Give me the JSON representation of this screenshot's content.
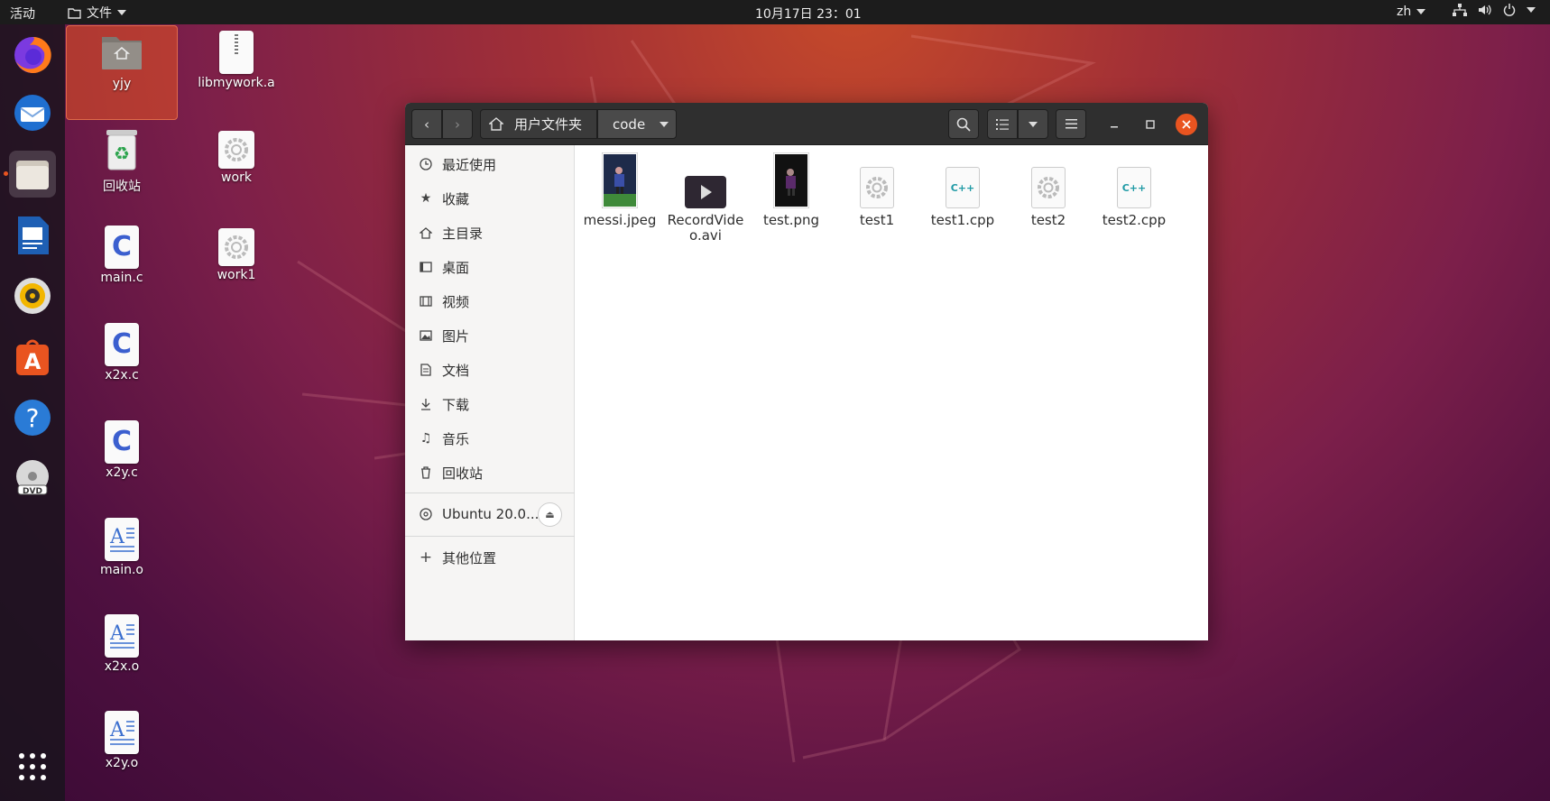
{
  "topbar": {
    "activities": "活动",
    "app_menu": "文件",
    "clock": "10月17日  23：01",
    "lang": "zh"
  },
  "dock": {
    "items": [
      "firefox-icon",
      "thunderbird-icon",
      "files-icon",
      "writer-icon",
      "rhythmbox-icon",
      "software-icon",
      "help-icon",
      "dvd-icon"
    ],
    "show_apps": "apps-grid-icon"
  },
  "desktop": {
    "icons": [
      {
        "label": "yjy"
      },
      {
        "label": "libmywork.a"
      },
      {
        "label": "回收站"
      },
      {
        "label": "work"
      },
      {
        "label": "main.c"
      },
      {
        "label": "work1"
      },
      {
        "label": "x2x.c"
      },
      {
        "label": "x2y.c"
      },
      {
        "label": "main.o"
      },
      {
        "label": "x2x.o"
      },
      {
        "label": "x2y.o"
      }
    ]
  },
  "window": {
    "path": [
      "用户文件夹",
      "code"
    ],
    "sidebar": {
      "items": [
        {
          "label": "最近使用",
          "icon": "clock-icon"
        },
        {
          "label": "收藏",
          "icon": "star-icon"
        },
        {
          "label": "主目录",
          "icon": "home-icon"
        },
        {
          "label": "桌面",
          "icon": "desktop-icon"
        },
        {
          "label": "视频",
          "icon": "video-icon"
        },
        {
          "label": "图片",
          "icon": "image-icon"
        },
        {
          "label": "文档",
          "icon": "document-icon"
        },
        {
          "label": "下载",
          "icon": "download-icon"
        },
        {
          "label": "音乐",
          "icon": "music-icon"
        },
        {
          "label": "回收站",
          "icon": "trash-icon"
        }
      ],
      "device": "Ubuntu 20.0...",
      "other": "其他位置"
    },
    "files": [
      {
        "name": "messi.jpeg",
        "type": "image"
      },
      {
        "name": "RecordVideo.avi",
        "type": "video"
      },
      {
        "name": "test.png",
        "type": "image"
      },
      {
        "name": "test1",
        "type": "executable"
      },
      {
        "name": "test1.cpp",
        "type": "cpp"
      },
      {
        "name": "test2",
        "type": "executable"
      },
      {
        "name": "test2.cpp",
        "type": "cpp"
      }
    ],
    "cpp_label": "C++"
  },
  "colors": {
    "accent": "#e95420",
    "topbar": "#1c1c1c",
    "headerbar": "#2f2f2f"
  }
}
